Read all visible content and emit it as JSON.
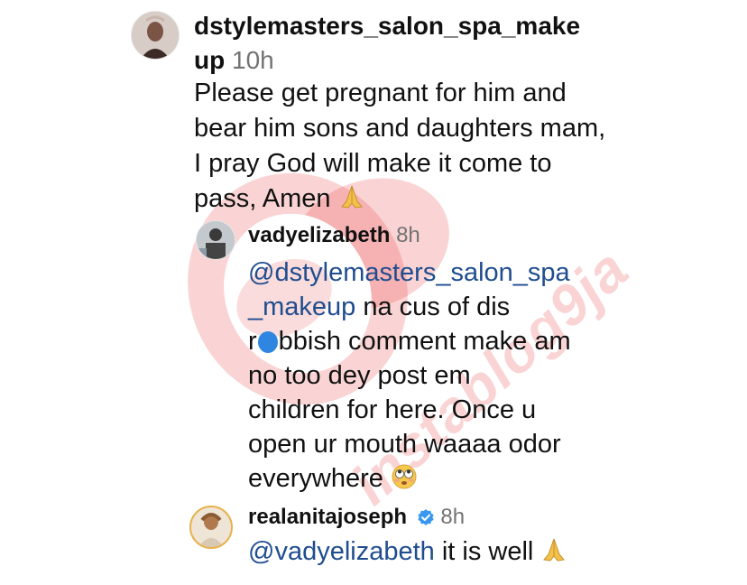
{
  "comments": [
    {
      "username": "dstylemasters_salon_spa_make\nup",
      "username_line1": "dstylemasters_salon_spa_make",
      "username_line2": "up",
      "time": "10h",
      "text": "Please get pregnant for him and bear him sons and daughters mam, I pray God will make it come to pass, Amen",
      "emoji": "folded-hands-icon"
    },
    {
      "username": "vadyelizabeth",
      "time": "8h",
      "mention_line1": "@dstylemasters_salon_spa",
      "mention_line2": "_makeup",
      "text_line2_rest": " na cus of dis",
      "text_line3_pre": "r",
      "text_line3_post": "bbish comment make am",
      "text_line4": "no too dey post em",
      "text_line5": "children for here. Once u",
      "text_line6": "open ur mouth waaaa odor",
      "text_line7": "everywhere",
      "emoji": "rolling-eyes-icon"
    },
    {
      "username": "realanitajoseph",
      "verified": true,
      "time": "8h",
      "mention": "@vadyelizabeth",
      "text": " it is well",
      "emoji": "folded-hands-icon"
    }
  ],
  "watermark": {
    "text": "instablog9ja",
    "color": "#e63c3c"
  }
}
